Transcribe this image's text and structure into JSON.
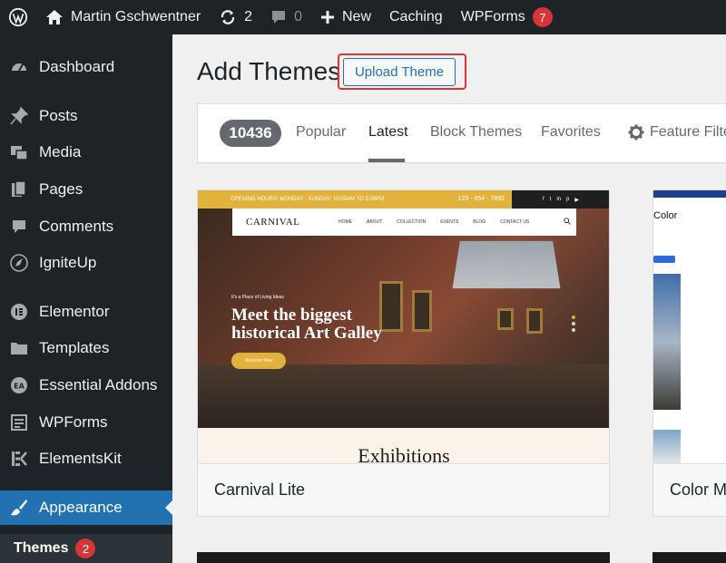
{
  "adminbar": {
    "site_name": "Martin Gschwentner",
    "updates_count": "2",
    "comments_count": "0",
    "new_label": "New",
    "caching_label": "Caching",
    "wpforms_label": "WPForms",
    "wpforms_badge": "7"
  },
  "sidebar": {
    "items": [
      {
        "label": "Dashboard",
        "icon": "dashboard-icon"
      },
      {
        "label": "Posts",
        "icon": "pin-icon"
      },
      {
        "label": "Media",
        "icon": "media-icon"
      },
      {
        "label": "Pages",
        "icon": "pages-icon"
      },
      {
        "label": "Comments",
        "icon": "comment-icon"
      },
      {
        "label": "IgniteUp",
        "icon": "rocket-icon"
      },
      {
        "label": "Elementor",
        "icon": "elementor-icon"
      },
      {
        "label": "Templates",
        "icon": "folder-icon"
      },
      {
        "label": "Essential Addons",
        "icon": "ea-icon"
      },
      {
        "label": "WPForms",
        "icon": "form-icon"
      },
      {
        "label": "ElementsKit",
        "icon": "ek-icon"
      },
      {
        "label": "Appearance",
        "icon": "brush-icon"
      }
    ],
    "submenu": {
      "label": "Themes",
      "badge": "2"
    }
  },
  "main": {
    "title": "Add Themes",
    "upload_button": "Upload Theme",
    "count": "10436",
    "tabs": [
      "Popular",
      "Latest",
      "Block Themes",
      "Favorites",
      "Feature Filter"
    ],
    "active_tab": "Latest"
  },
  "themes": [
    {
      "name": "Carnival Lite",
      "preview": {
        "topbar_text": "OPENING HOURS: MONDAY - SUNDAY: 10:00AM TO 5:00PM",
        "phone": "123 - 654 - 7892",
        "logo": "CARNIVAL",
        "nav": [
          "HOME",
          "ABOUT",
          "COLLECTION",
          "EVENTS",
          "BLOG",
          "CONTACT US"
        ],
        "kicker": "It's a Place of Living Ideas",
        "headline": "Meet the biggest historical Art Galley",
        "cta": "Discover Now",
        "section_title": "Exhibitions"
      }
    },
    {
      "name": "Color M",
      "preview": {
        "title": "Color"
      }
    }
  ],
  "colors": {
    "admin_dark": "#1d2327",
    "accent_blue": "#2271b1",
    "badge_red": "#d63638",
    "carnival_gold": "#e2b33c"
  }
}
